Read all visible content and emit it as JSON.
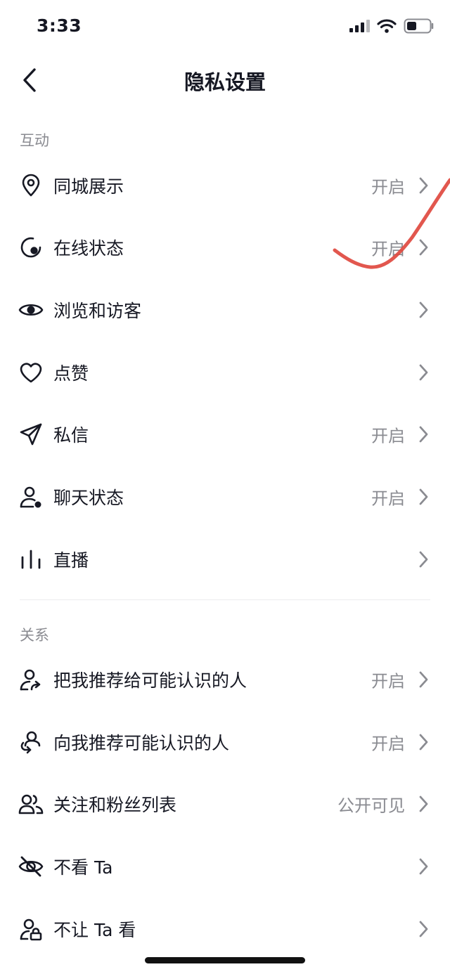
{
  "status_bar": {
    "time": "3:33"
  },
  "header": {
    "title": "隐私设置",
    "back_icon": "chevron-left-icon"
  },
  "sections": [
    {
      "title": "互动",
      "items": [
        {
          "label": "同城展示",
          "value": "开启",
          "icon": "location-pin-icon"
        },
        {
          "label": "在线状态",
          "value": "开启",
          "icon": "online-status-icon"
        },
        {
          "label": "浏览和访客",
          "value": "",
          "icon": "eye-icon"
        },
        {
          "label": "点赞",
          "value": "",
          "icon": "heart-icon"
        },
        {
          "label": "私信",
          "value": "开启",
          "icon": "paper-plane-icon"
        },
        {
          "label": "聊天状态",
          "value": "开启",
          "icon": "user-dot-icon"
        },
        {
          "label": "直播",
          "value": "",
          "icon": "live-bars-icon"
        }
      ]
    },
    {
      "title": "关系",
      "items": [
        {
          "label": "把我推荐给可能认识的人",
          "value": "开启",
          "icon": "user-share-icon"
        },
        {
          "label": "向我推荐可能认识的人",
          "value": "开启",
          "icon": "user-recommend-icon"
        },
        {
          "label": "关注和粉丝列表",
          "value": "公开可见",
          "icon": "users-icon"
        },
        {
          "label": "不看 Ta",
          "value": "",
          "icon": "eye-off-icon"
        },
        {
          "label": "不让 Ta 看",
          "value": "",
          "icon": "user-lock-icon"
        }
      ]
    }
  ],
  "colors": {
    "text": "#161823",
    "secondary": "#8a8b91",
    "annotation_stroke": "#e0493f"
  }
}
